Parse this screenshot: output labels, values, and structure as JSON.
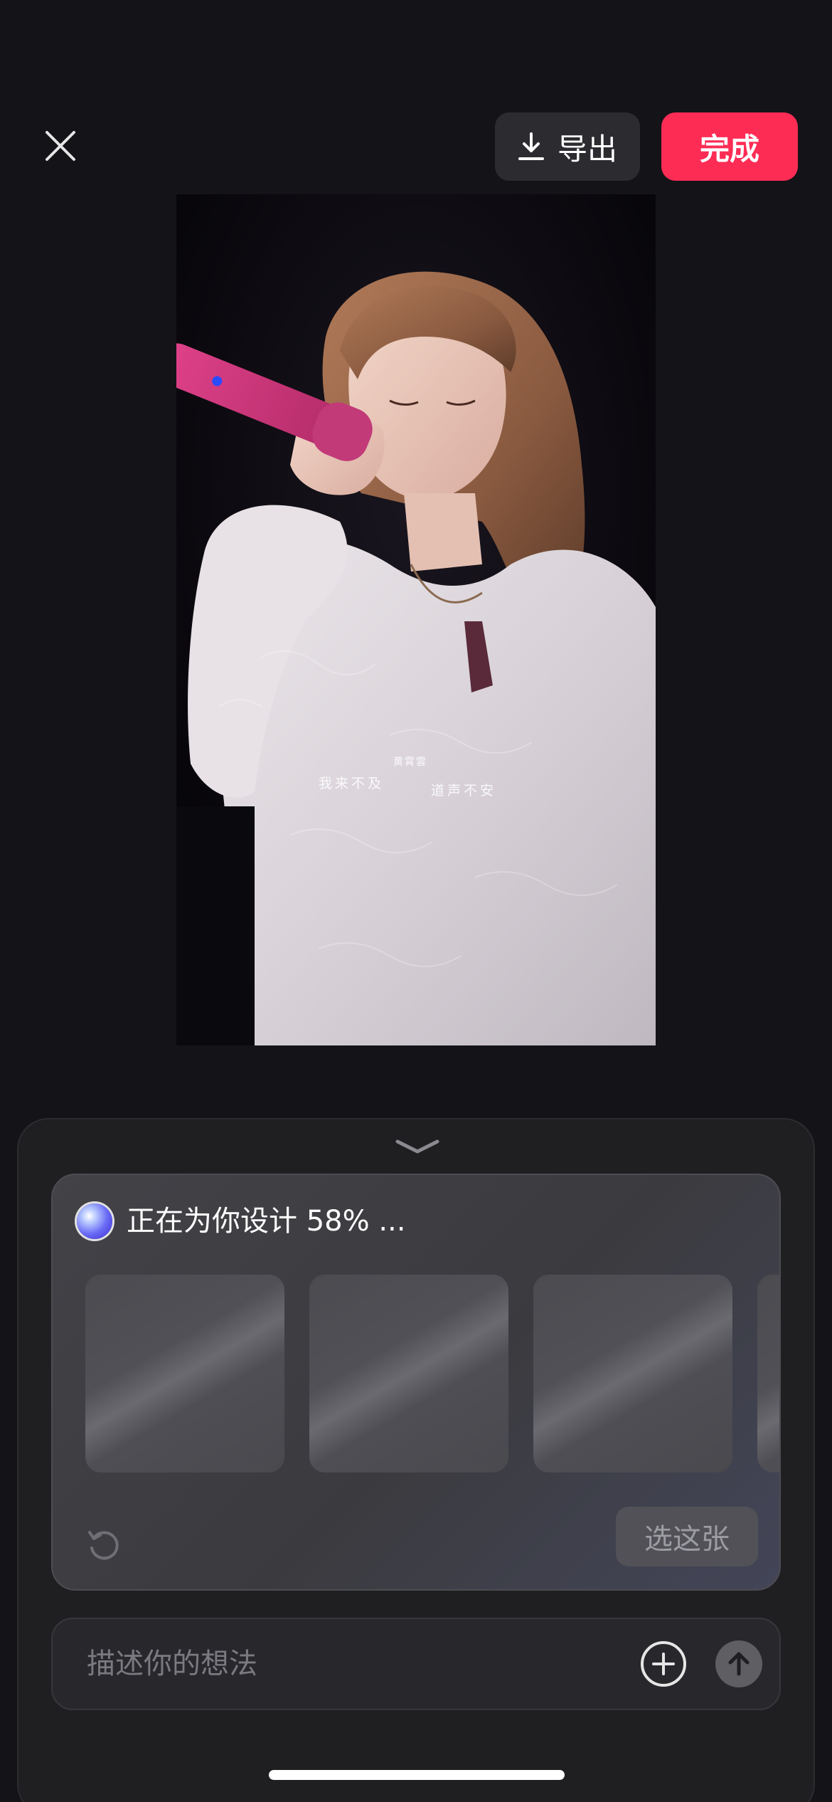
{
  "toolbar": {
    "close_icon": "close-icon",
    "export_label": "导出",
    "export_icon": "download-icon",
    "done_label": "完成",
    "done_color": "#fd2c55"
  },
  "preview": {
    "overlay_lyrics": {
      "small": "黄霄雲",
      "left": "我来不及",
      "right": "道声不安"
    }
  },
  "sheet": {
    "collapse_icon": "chevron-down-icon",
    "design": {
      "status_text": "正在为你设计 58% ...",
      "progress_percent": 58,
      "orb_icon": "ai-orb-icon",
      "thumbnails_count_visible": 4,
      "regenerate_icon": "refresh-icon",
      "pick_label": "选这张"
    },
    "input": {
      "placeholder": "描述你的想法",
      "value": "",
      "add_icon": "plus-circle-icon",
      "send_icon": "arrow-up-icon"
    }
  },
  "colors": {
    "background": "#141318",
    "sheet": "#1f1f22",
    "accent": "#fd2c55"
  }
}
